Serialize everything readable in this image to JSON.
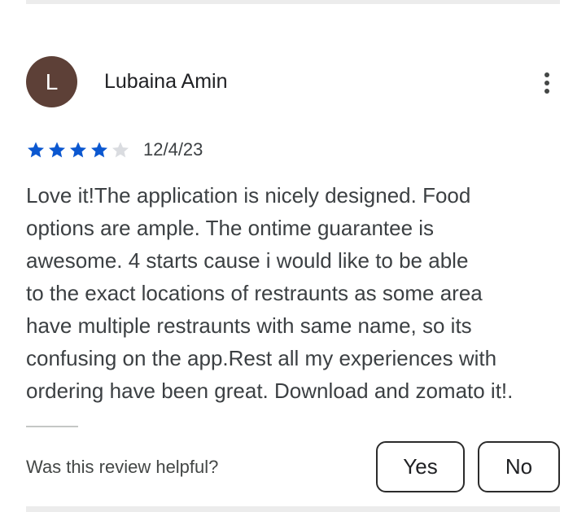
{
  "review": {
    "avatar_letter": "L",
    "avatar_color": "#5d4037",
    "reviewer_name": "Lubaina Amin",
    "menu_icon": "more-vertical-icon",
    "rating": 4,
    "max_rating": 5,
    "star_color_filled": "#0b57d0",
    "star_color_empty": "#dadce0",
    "date": "12/4/23",
    "text": "Love it!The application is nicely designed. Food\noptions are ample. The ontime guarantee is\nawesome. 4 starts cause i would like to be able\nto the exact locations of restraunts as some area\nhave multiple restraunts with same name, so its\nconfusing on the app.Rest all my experiences with\nordering have been great. Download and zomato it!."
  },
  "feedback": {
    "question": "Was this review helpful?",
    "yes_label": "Yes",
    "no_label": "No"
  }
}
